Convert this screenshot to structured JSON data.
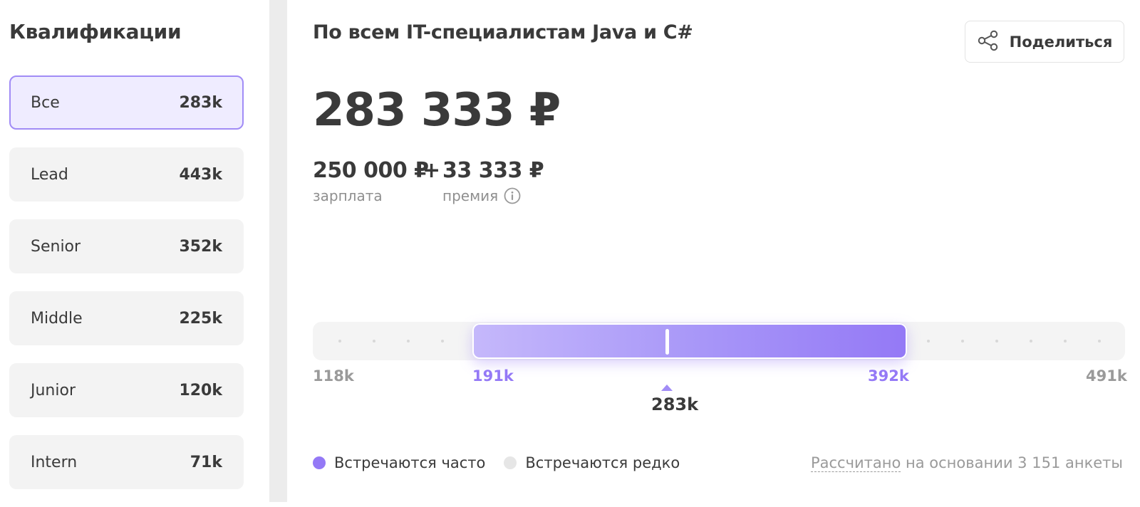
{
  "sidebar": {
    "title": "Квалификации",
    "items": [
      {
        "label": "Все",
        "value": "283k"
      },
      {
        "label": "Lead",
        "value": "443k"
      },
      {
        "label": "Senior",
        "value": "352k"
      },
      {
        "label": "Middle",
        "value": "225k"
      },
      {
        "label": "Junior",
        "value": "120k"
      },
      {
        "label": "Intern",
        "value": "71k"
      }
    ]
  },
  "main": {
    "title": "По всем IT-специалистам Java и C#",
    "share_label": "Поделиться",
    "total": "283 333 ₽",
    "salary_amount": "250 000 ₽",
    "plus": "+",
    "bonus_amount": "33 333 ₽",
    "salary_caption": "зарплата",
    "bonus_caption": "премия"
  },
  "range_chart": {
    "min_label": "118k",
    "low_label": "191k",
    "high_label": "392k",
    "max_label": "491k",
    "median_label": "283k"
  },
  "legend": {
    "frequent": "Встречаются часто",
    "rare": "Встречаются редко"
  },
  "footnote": {
    "link": "Рассчитано",
    "rest": " на основании 3 151 анкеты"
  },
  "colors": {
    "accent": "#9479f6",
    "accent_light": "#c5b8fb",
    "active_bg": "#efecff",
    "rare_dot": "#e6e6e6"
  }
}
